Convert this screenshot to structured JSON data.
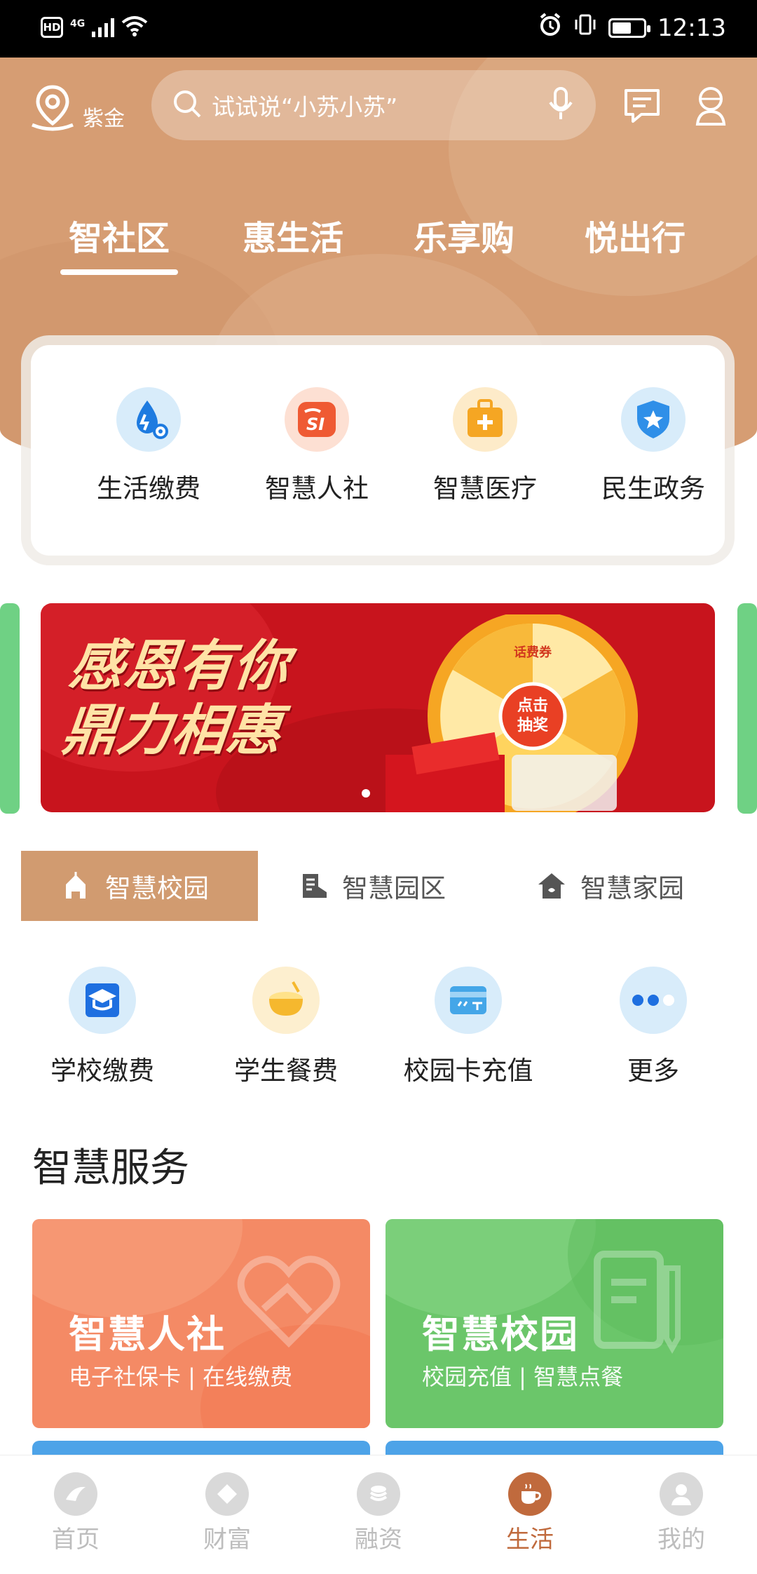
{
  "status_bar": {
    "network_type": "4G",
    "badge": "HD",
    "time": "12:13"
  },
  "header": {
    "location_label": "紫金",
    "search_placeholder": "试试说“小苏小苏”",
    "tabs": [
      {
        "label": "智社区",
        "active": true
      },
      {
        "label": "惠生活",
        "active": false
      },
      {
        "label": "乐享购",
        "active": false
      },
      {
        "label": "悦出行",
        "active": false
      }
    ]
  },
  "quick_services": [
    {
      "label": "生活缴费",
      "icon": "water-drop-gear-icon"
    },
    {
      "label": "智慧人社",
      "icon": "si-logo-icon"
    },
    {
      "label": "智慧医疗",
      "icon": "medical-kit-icon"
    },
    {
      "label": "民生政务",
      "icon": "shield-star-icon"
    }
  ],
  "banner": {
    "title_line1": "感恩有你",
    "title_line2": "鼎力相惠",
    "wheel_center_line1": "点击",
    "wheel_center_line2": "抽奖",
    "wheel_segment": "话费券",
    "slide_count": 1,
    "current_slide": 1
  },
  "segments": [
    {
      "label": "智慧校园",
      "icon": "campus-icon",
      "active": true
    },
    {
      "label": "智慧园区",
      "icon": "park-building-icon",
      "active": false
    },
    {
      "label": "智慧家园",
      "icon": "home-icon",
      "active": false
    }
  ],
  "campus_services": [
    {
      "label": "学校缴费",
      "icon": "graduation-cap-icon"
    },
    {
      "label": "学生餐费",
      "icon": "rice-bowl-icon"
    },
    {
      "label": "校园卡充值",
      "icon": "card-icon"
    },
    {
      "label": "更多",
      "icon": "more-dots-icon"
    }
  ],
  "section_title": "智慧服务",
  "service_cards": [
    {
      "title": "智慧人社",
      "subtitle": "电子社保卡 | 在线缴费",
      "icon": "handshake-heart-icon",
      "color": "#f48a65"
    },
    {
      "title": "智慧校园",
      "subtitle": "校园充值 | 智慧点餐",
      "icon": "book-pen-icon",
      "color": "#6bc66a"
    }
  ],
  "bottom_nav": [
    {
      "label": "首页",
      "icon": "home-logo-icon",
      "active": false
    },
    {
      "label": "财富",
      "icon": "wealth-icon",
      "active": false
    },
    {
      "label": "融资",
      "icon": "coins-icon",
      "active": false
    },
    {
      "label": "生活",
      "icon": "coffee-cup-icon",
      "active": true
    },
    {
      "label": "我的",
      "icon": "user-icon",
      "active": false
    }
  ],
  "colors": {
    "header_bg": "#d69d73",
    "accent": "#c06a3d",
    "segment_active": "#d19b70",
    "banner_red": "#c8141d"
  }
}
